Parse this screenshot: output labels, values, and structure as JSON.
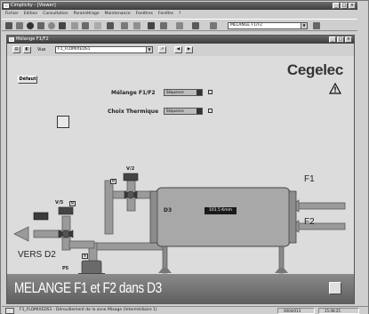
{
  "app": {
    "title": "Cimplicity - [Viewer]",
    "menu": [
      "Fichier",
      "Edition",
      "Consultation",
      "Paramétrage",
      "Maintenance",
      "Fenêtres",
      "Fenêtre",
      "?"
    ],
    "toolbar_combo": "MELANGE F1/F2"
  },
  "window": {
    "title": "Mélange F1/F2",
    "vue_label": "Vue",
    "vue_value": "F1_FLOMIXEDS1"
  },
  "synoptic": {
    "logo": "Cegelec",
    "diag_button": "Défaut",
    "param1_label": "Mélange F1/F2",
    "param1_value": "Séquence",
    "param2_label": "Choix Thermique",
    "param2_value": "Séquence",
    "f1_label": "F1",
    "f2_label": "F2",
    "vers_label": "VERS D2",
    "v2_tag": "V/2",
    "v5_tag": "V/5",
    "p5_tag": "P5",
    "d3_tag": "D3",
    "tank_value": "101.5 Kmm",
    "tag_m": "M",
    "banner_title": "MELANGE F1 et F2 dans D3"
  },
  "status": {
    "text": "F1_FLOMIXEDS1 - Dérouillement de la zone Mixage (Intermédiaire 1)",
    "cell1": "0004/013",
    "cell2": "15:08:25"
  },
  "colors": {
    "pipe": "#9a9a9a",
    "pipe_dark": "#5c5c5c",
    "tank": "#a8a8a8",
    "banner": "#707070"
  }
}
